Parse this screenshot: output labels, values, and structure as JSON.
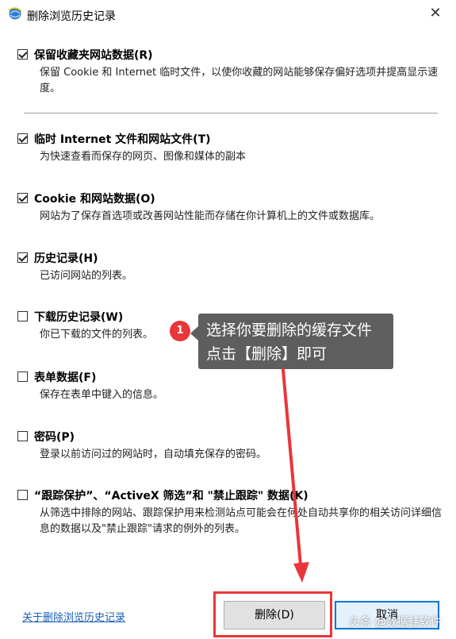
{
  "window": {
    "title": "删除浏览历史记录",
    "close_glyph": "✕"
  },
  "options": [
    {
      "label": "保留收藏夹网站数据(R)",
      "checked": true,
      "desc": "保留 Cookie 和 Internet 临时文件，以使你收藏的网站能够保存偏好选项并提高显示速度。"
    },
    {
      "label": "临时 Internet 文件和网站文件(T)",
      "checked": true,
      "desc": "为快速查看而保存的网页、图像和媒体的副本"
    },
    {
      "label": "Cookie 和网站数据(O)",
      "checked": true,
      "desc": "网站为了保存首选项或改善网站性能而存储在你计算机上的文件或数据库。"
    },
    {
      "label": "历史记录(H)",
      "checked": true,
      "desc": "已访问网站的列表。"
    },
    {
      "label": "下载历史记录(W)",
      "checked": false,
      "desc": "你已下载的文件的列表。"
    },
    {
      "label": "表单数据(F)",
      "checked": false,
      "desc": "保存在表单中键入的信息。"
    },
    {
      "label": "密码(P)",
      "checked": false,
      "desc": "登录以前访问过的网站时，自动填充保存的密码。"
    },
    {
      "label": "“跟踪保护”、“ActiveX 筛选”和 \"禁止跟踪\" 数据(K)",
      "checked": false,
      "desc": "从筛选中排除的网站、跟踪保护用来检测站点可能会在何处自动共享你的相关访问详细信息的数据以及\"禁止跟踪\"请求的例外的列表。"
    }
  ],
  "annotation": {
    "step": "1",
    "text_line1": "选择你要删除的缓存文件",
    "text_line2": "点击【删除】即可",
    "accent": "#e8363b"
  },
  "footer": {
    "about_link": "关于删除浏览历史记录",
    "delete_label": "删除(D)",
    "cancel_label": "取消"
  },
  "watermark": "头条 @数据蛙软件",
  "colors": {
    "link": "#1a5fb4",
    "primary_border": "#0078d7",
    "highlight": "#e8363b"
  },
  "icons": {
    "app": "ie-globe-icon",
    "close": "close-icon"
  }
}
